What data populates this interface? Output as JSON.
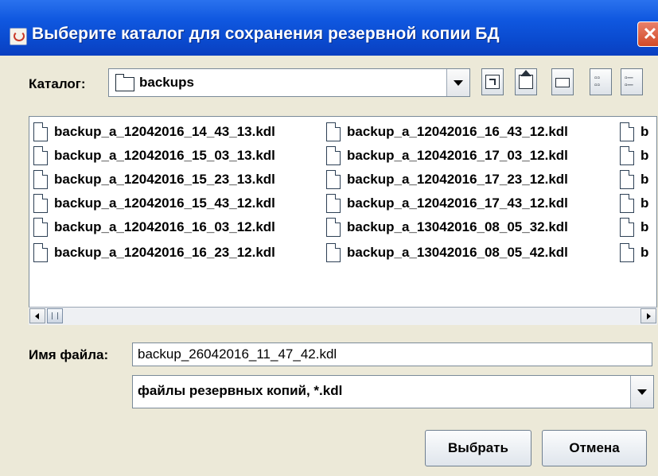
{
  "window": {
    "title": "Выберите каталог для сохранения резервной копии БД",
    "close_symbol": "✕"
  },
  "toolbar": {
    "catalog_label": "Каталог:",
    "catalog_value": "backups",
    "buttons": [
      "up-one-level",
      "home",
      "new-folder",
      "list-view",
      "details-view"
    ]
  },
  "files": {
    "column1": [
      "backup_a_12042016_14_43_13.kdl",
      "backup_a_12042016_15_03_13.kdl",
      "backup_a_12042016_15_23_13.kdl",
      "backup_a_12042016_15_43_12.kdl",
      "backup_a_12042016_16_03_12.kdl",
      "backup_a_12042016_16_23_12.kdl"
    ],
    "column2": [
      "backup_a_12042016_16_43_12.kdl",
      "backup_a_12042016_17_03_12.kdl",
      "backup_a_12042016_17_23_12.kdl",
      "backup_a_12042016_17_43_12.kdl",
      "backup_a_13042016_08_05_32.kdl",
      "backup_a_13042016_08_05_42.kdl"
    ],
    "column3": [
      "b",
      "b",
      "b",
      "b",
      "b",
      "b"
    ]
  },
  "filename": {
    "label": "Имя файла:",
    "value": "backup_26042016_11_47_42.kdl"
  },
  "filter": {
    "value": "файлы резервных копий, *.kdl"
  },
  "actions": {
    "select": "Выбрать",
    "cancel": "Отмена"
  }
}
